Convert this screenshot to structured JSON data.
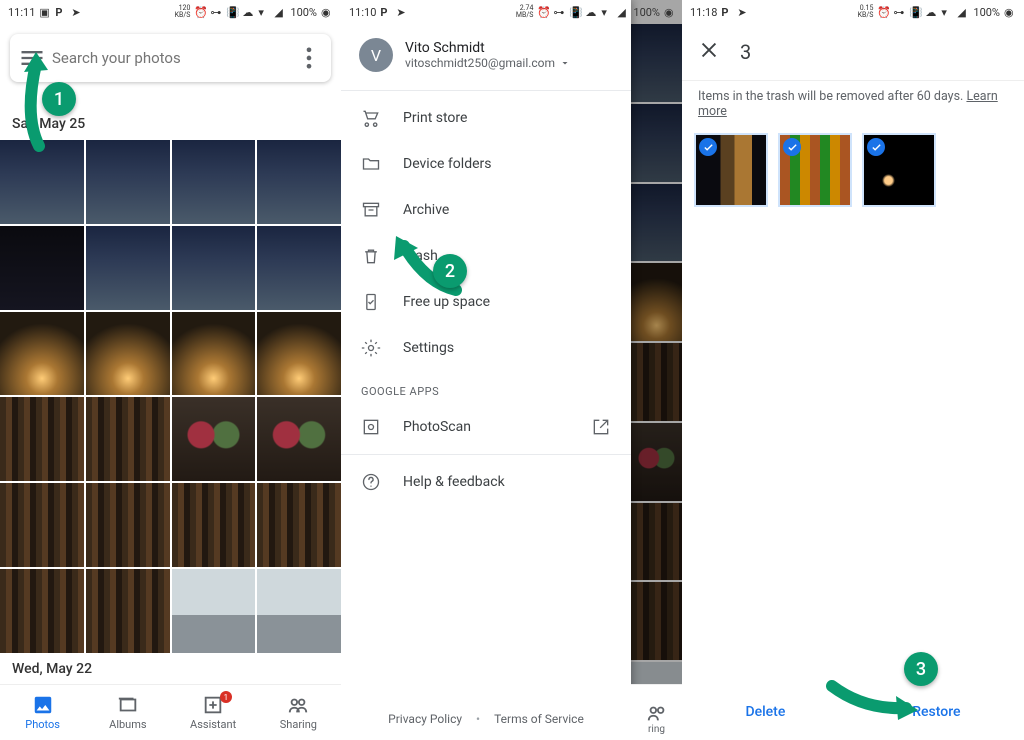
{
  "status": {
    "s1": {
      "time": "11:11",
      "rate_top": "120",
      "rate_bot": "KB/S",
      "battery": "100%"
    },
    "s2": {
      "time": "11:10",
      "rate_top": "2.74",
      "rate_bot": "MB/S",
      "battery": "100%"
    },
    "s3": {
      "time": "11:18",
      "rate_top": "0.15",
      "rate_bot": "KB/S",
      "battery": "100%"
    }
  },
  "s1": {
    "search_placeholder": "Search your photos",
    "date1": "Sat, May 25",
    "date2": "Wed, May 22",
    "nav": {
      "photos": "Photos",
      "albums": "Albums",
      "assistant": "Assistant",
      "sharing": "Sharing",
      "badge": "1"
    }
  },
  "s2": {
    "account": {
      "initial": "V",
      "name": "Vito Schmidt",
      "email": "vitoschmidt250@gmail.com"
    },
    "items": {
      "print": "Print store",
      "device": "Device folders",
      "archive": "Archive",
      "trash": "Trash",
      "free": "Free up space",
      "settings": "Settings",
      "head": "GOOGLE APPS",
      "photoscan": "PhotoScan",
      "help": "Help & feedback"
    },
    "foot": {
      "pp": "Privacy Policy",
      "tos": "Terms of Service"
    }
  },
  "s3": {
    "count": "3",
    "note": "Items in the trash will be removed after 60 days. ",
    "learn": "Learn more",
    "delete": "Delete",
    "restore": "Restore"
  },
  "anno": {
    "a1": "1",
    "a2": "2",
    "a3": "3"
  }
}
